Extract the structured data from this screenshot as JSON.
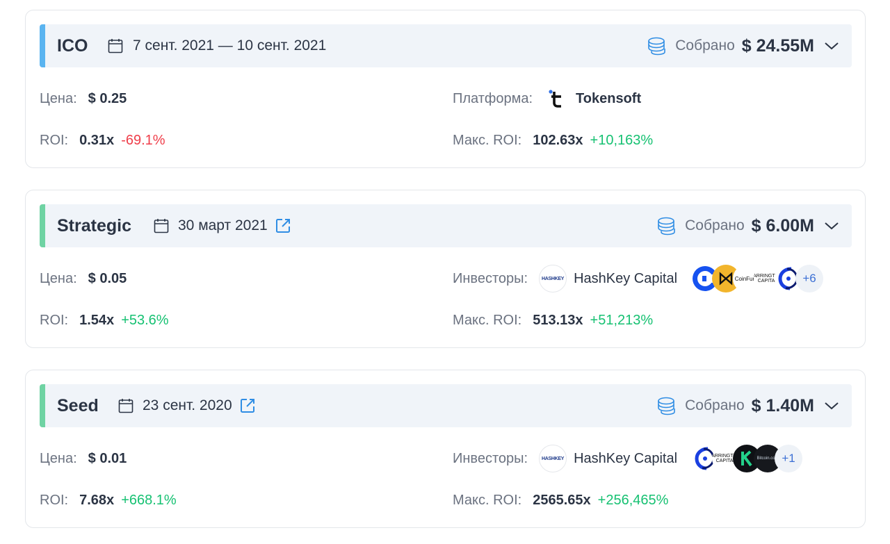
{
  "colors": {
    "ico_accent": "#5ab4f0",
    "strategic_accent": "#6fd3a3",
    "seed_accent": "#6fd3a3",
    "negative": "#ef3e4a",
    "positive": "#16c172",
    "link": "#2f8de4"
  },
  "labels": {
    "raised": "Собрано",
    "price": "Цена:",
    "roi": "ROI:",
    "max_roi": "Макс. ROI:",
    "platform": "Платформа:",
    "investors": "Инвесторы:"
  },
  "rounds": [
    {
      "name": "ICO",
      "date": "7 сент. 2021 — 10 сент. 2021",
      "raised": "$ 24.55M",
      "price": "$ 0.25",
      "roi": "0.31x",
      "roi_change": "-69.1%",
      "max_roi": "102.63x",
      "max_roi_change": "+10,163%",
      "platform": "Tokensoft"
    },
    {
      "name": "Strategic",
      "date": "30 март 2021",
      "raised": "$ 6.00M",
      "price": "$ 0.05",
      "roi": "1.54x",
      "roi_change": "+53.6%",
      "max_roi": "513.13x",
      "max_roi_change": "+51,213%",
      "lead_investor": "HashKey Capital",
      "lead_logo_text": "HASHKEY",
      "more_count": "+6",
      "avatar_texts": {
        "coinfund": "CoinFund",
        "arrington": "ARRINGTON CAPITAL"
      }
    },
    {
      "name": "Seed",
      "date": "23 сент. 2020",
      "raised": "$ 1.40M",
      "price": "$ 0.01",
      "roi": "7.68x",
      "roi_change": "+668.1%",
      "max_roi": "2565.65x",
      "max_roi_change": "+256,465%",
      "lead_investor": "HashKey Capital",
      "lead_logo_text": "HASHKEY",
      "more_count": "+1",
      "avatar_texts": {
        "arrington": "ARRINGTON CAPITAL",
        "bitcoin": "Bitcoin.com"
      }
    }
  ]
}
